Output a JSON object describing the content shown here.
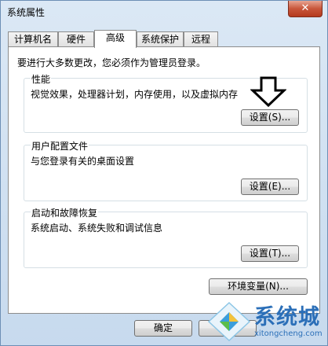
{
  "window": {
    "title": "系统属性",
    "close_label": "✕"
  },
  "tabs": [
    "计算机名",
    "硬件",
    "高级",
    "系统保护",
    "远程"
  ],
  "active_tab": "高级",
  "intro": "要进行大多数更改，您必须作为管理员登录。",
  "performance": {
    "title": "性能",
    "description": "视觉效果，处理器计划，内存使用，以及虚拟内存",
    "button": "设置(S)..."
  },
  "user_profiles": {
    "title": "用户配置文件",
    "description": "与您登录有关的桌面设置",
    "button": "设置(E)..."
  },
  "startup_recovery": {
    "title": "启动和故障恢复",
    "description": "系统启动、系统失败和调试信息",
    "button": "设置(T)..."
  },
  "env_button": "环境变量(N)...",
  "footer": {
    "ok": "确定",
    "cancel": "取消"
  },
  "watermark": {
    "text": "系统城",
    "url": "xitongcheng.com"
  }
}
